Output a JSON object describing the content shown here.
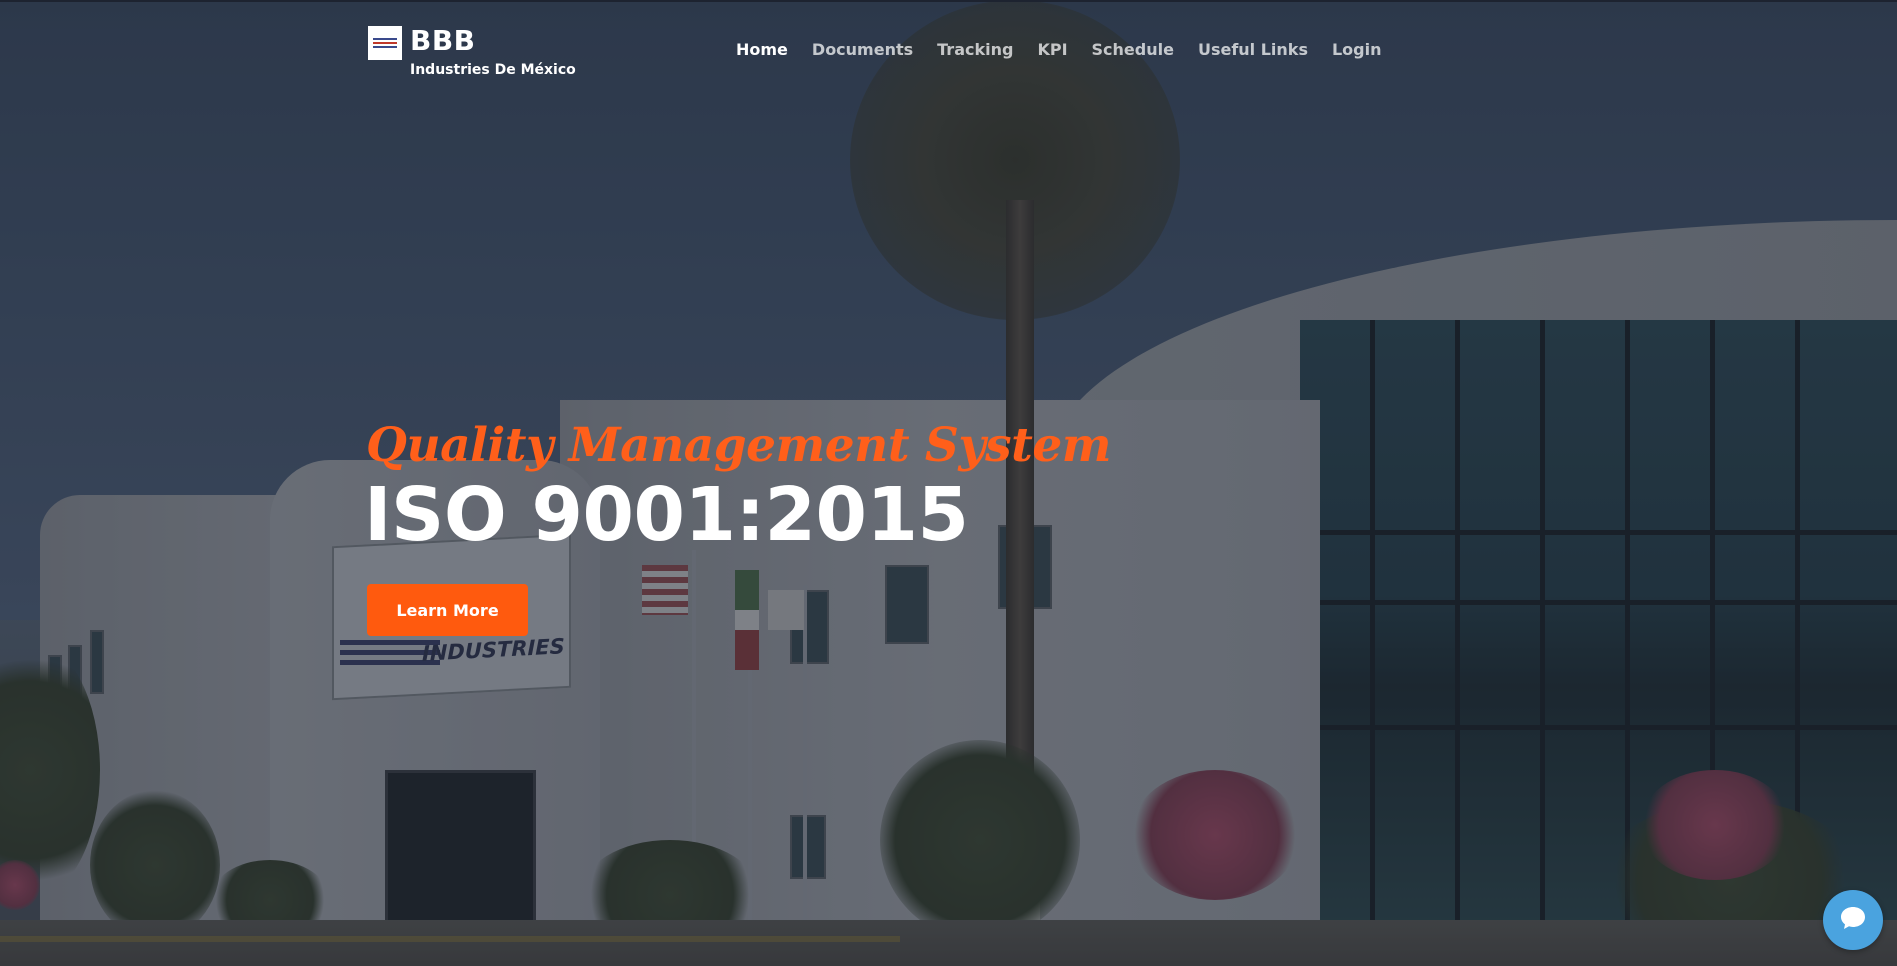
{
  "header": {
    "brand_title": "BBB",
    "brand_subtitle": "Industries De México",
    "logo_icon": "bbb-logo-icon"
  },
  "nav": {
    "items": [
      {
        "label": "Home",
        "active": true
      },
      {
        "label": "Documents",
        "active": false
      },
      {
        "label": "Tracking",
        "active": false
      },
      {
        "label": "KPI",
        "active": false
      },
      {
        "label": "Schedule",
        "active": false
      },
      {
        "label": "Useful Links",
        "active": false
      },
      {
        "label": "Login",
        "active": false
      }
    ]
  },
  "hero": {
    "subtitle": "Quality Management System",
    "title": "ISO 9001:2015",
    "cta_label": "Learn More",
    "building_sign": "INDUSTRIES"
  },
  "chat_widget": {
    "icon": "chat-bubble-icon"
  },
  "colors": {
    "accent": "#ff5a0e",
    "chat": "#4aa3df",
    "text": "#ffffff"
  }
}
